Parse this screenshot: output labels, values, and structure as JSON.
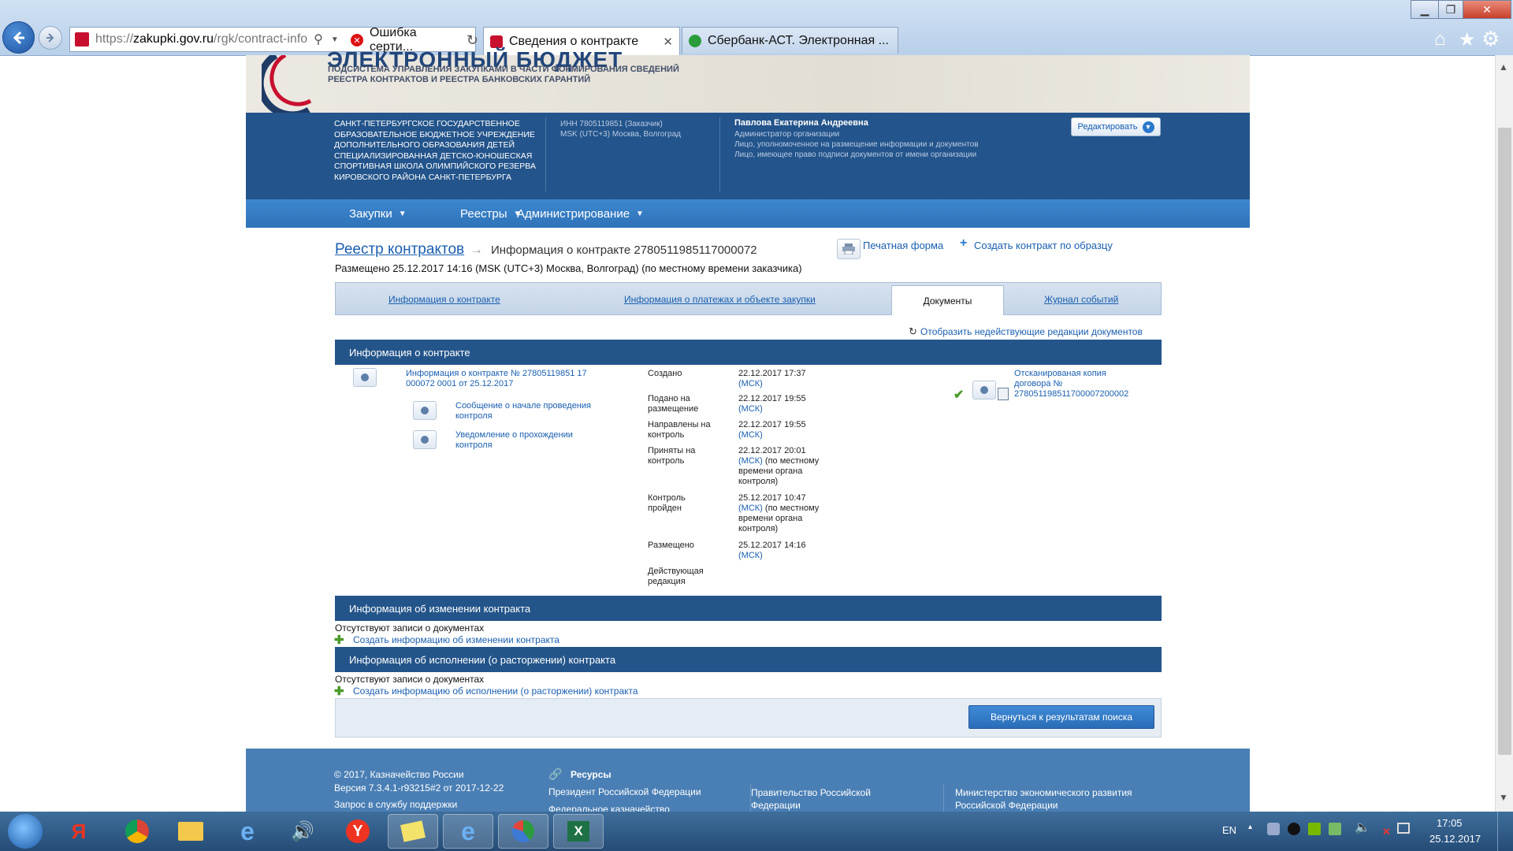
{
  "browser": {
    "url_prefix": "https://",
    "url_host": "zakupki.gov.ru",
    "url_path": "/rgk/contract-info",
    "tabs": [
      {
        "label": "Ошибка серти..."
      },
      {
        "label": "Сведения о контракте"
      },
      {
        "label": "Сбербанк-АСТ. Электронная ..."
      }
    ]
  },
  "banner": {
    "title": "ЭЛЕКТРОННЫЙ БЮДЖЕТ",
    "subtitle_line1": "ПОДСИСТЕМА УПРАВЛЕНИЯ ЗАКУПКАМИ В ЧАСТИ ФОРМИРОВАНИЯ СВЕДЕНИЙ",
    "subtitle_line2": "РЕЕСТРА КОНТРАКТОВ И РЕЕСТРА БАНКОВСКИХ ГАРАНТИЙ"
  },
  "org": {
    "name": "САНКТ-ПЕТЕРБУРГСКОЕ ГОСУДАРСТВЕННОЕ ОБРАЗОВАТЕЛЬНОЕ БЮДЖЕТНОЕ УЧРЕЖДЕНИЕ ДОПОЛНИТЕЛЬНОГО ОБРАЗОВАНИЯ ДЕТЕЙ СПЕЦИАЛИЗИРОВАННАЯ ДЕТСКО-ЮНОШЕСКАЯ СПОРТИВНАЯ ШКОЛА ОЛИМПИЙСКОГО РЕЗЕРВА КИРОВСКОГО РАЙОНА САНКТ-ПЕТЕРБУРГА",
    "inn": "ИНН 7805119851 (Заказчик)",
    "timezone": "MSK (UTC+3) Москва, Волгоград",
    "user_name": "Павлова Екатерина Андреевна",
    "role1": "Администратор организации",
    "role2": "Лицо, уполномоченное на размещение информации и документов",
    "role3": "Лицо, имеющее право подписи документов от имени организации",
    "edit_label": "Редактировать"
  },
  "menu": [
    {
      "label": "Закупки"
    },
    {
      "label": "Реестры"
    },
    {
      "label": "Администрирование"
    }
  ],
  "breadcrumb": {
    "root": "Реестр контрактов",
    "arrow": "→",
    "current": "Информация о контракте 2780511985117000072"
  },
  "actions": {
    "print": "Печатная форма",
    "create_by_sample": "Создать контракт по образцу"
  },
  "posted": "Размещено 25.12.2017 14:16 (MSK (UTC+3) Москва, Волгоград) (по местному времени заказчика)",
  "page_tabs": [
    {
      "label": "Информация о контракте"
    },
    {
      "label": "Информация о платежах и объекте закупки"
    },
    {
      "label": "Документы"
    },
    {
      "label": "Журнал событий"
    }
  ],
  "show_inactive": "Отобразить недействующие редакции документов",
  "section_info": {
    "title": "Информация о контракте",
    "doc_main": "Информация о контракте № 27805119851 17 000072 0001 от 25.12.2017",
    "doc_sub1": "Сообщение о начале проведения контроля",
    "doc_sub2": "Уведомление о прохождении контроля",
    "events": [
      {
        "label": "Создано",
        "date": "22.12.2017 17:37",
        "tz": "(МСК)",
        "extra": ""
      },
      {
        "label": "Подано на размещение",
        "date": "22.12.2017 19:55",
        "tz": "(МСК)",
        "extra": ""
      },
      {
        "label": "Направлены на контроль",
        "date": "22.12.2017 19:55",
        "tz": "(МСК)",
        "extra": ""
      },
      {
        "label": "Приняты на контроль",
        "date": "22.12.2017 20:01",
        "tz": "(МСК)",
        "extra": "(по местному времени органа контроля)"
      },
      {
        "label": "Контроль пройден",
        "date": "25.12.2017 10:47",
        "tz": "(МСК)",
        "extra": "(по местному времени органа контроля)"
      },
      {
        "label": "Размещено",
        "date": "25.12.2017 14:16",
        "tz": "(МСК)",
        "extra": ""
      },
      {
        "label": "Действующая редакция",
        "date": "",
        "tz": "",
        "extra": ""
      }
    ],
    "scan_copy": "Отсканированая копия договора № 278051198511700007200002"
  },
  "section_change": {
    "title": "Информация об изменении контракта",
    "empty": "Отсутствуют записи о документах",
    "create": "Создать информацию об изменении контракта"
  },
  "section_exec": {
    "title": "Информация об исполнении (о расторжении) контракта",
    "empty": "Отсутствуют записи о документах",
    "create": "Создать информацию об исполнении (о расторжении) контракта"
  },
  "back_button": "Вернуться к результатам поиска",
  "footer": {
    "copyright": "© 2017, Казначейство России",
    "version": "Версия 7.3.4.1-r93215#2 от 2017-12-22",
    "support": "Запрос в службу поддержки",
    "resources_title": "Ресурсы",
    "link1": "Президент Российской Федерации",
    "link1b": "Федеральное казначейство",
    "link2": "Правительство Российской Федерации",
    "link3": "Министерство экономического развития Российской Федерации"
  },
  "taskbar": {
    "lang": "EN",
    "time": "17:05",
    "date": "25.12.2017"
  },
  "colors": {
    "org_bar": "#23548b",
    "menu_bar": "#2f73b8",
    "section_header": "#24558a",
    "link": "#1a5fb0",
    "footer": "#4a7fb5"
  }
}
